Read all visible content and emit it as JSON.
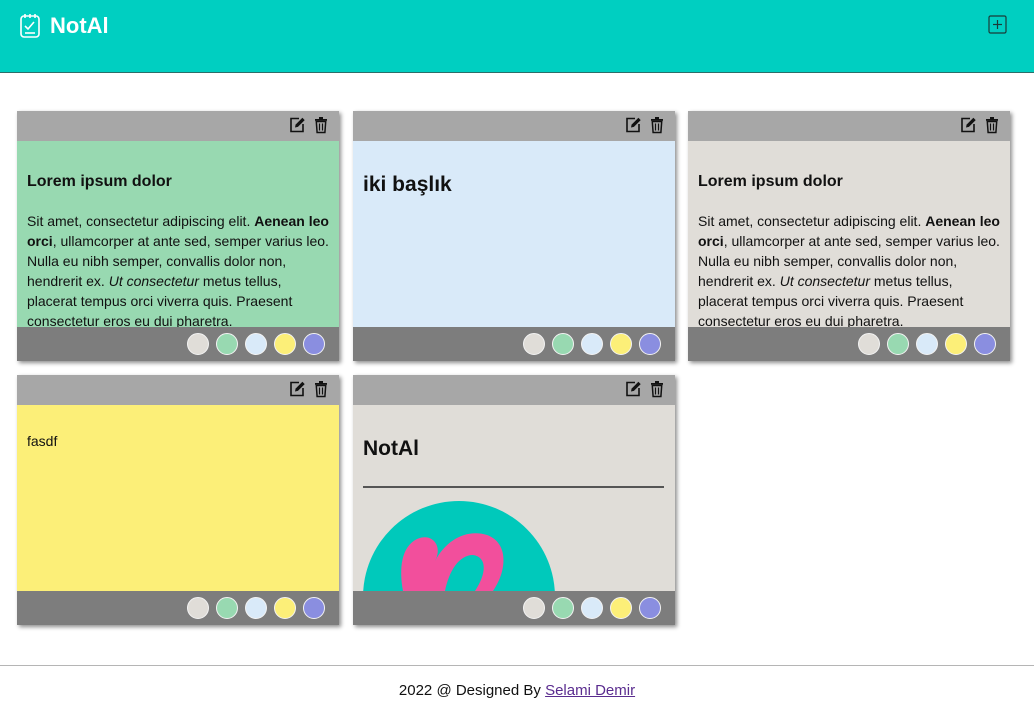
{
  "app": {
    "title": "NotAl",
    "logo_icon": "notepad-check-icon",
    "add_icon": "plus-square-icon",
    "accent": "#00cfc1"
  },
  "note_toolbar": {
    "edit_icon": "edit-icon",
    "delete_icon": "trash-icon"
  },
  "palette": [
    "#e0ddd8",
    "#98d9b1",
    "#d9eaf9",
    "#fcef78",
    "#8a8ee0"
  ],
  "notes": [
    {
      "color": "#98d9b1",
      "title": "Lorem ipsum dolor",
      "body": {
        "t1": "Sit amet, consectetur adipiscing elit. ",
        "b1": "Aenean leo orci",
        "t2": ", ullamcorper at ante sed, semper varius leo. Nulla eu nibh semper, convallis dolor non, hendrerit ex. ",
        "i1": "Ut consectetur",
        "t3": " metus tellus, placerat tempus orci viverra quis. Praesent consectetur eros eu dui pharetra."
      }
    },
    {
      "color": "#d9eaf9",
      "title": "iki başlık"
    },
    {
      "color": "#e0ddd8",
      "title": "Lorem ipsum dolor",
      "body": {
        "t1": "Sit amet, consectetur adipiscing elit. ",
        "b1": "Aenean leo orci",
        "t2": ", ullamcorper at ante sed, semper varius leo. Nulla eu nibh semper, convallis dolor non, hendrerit ex. ",
        "i1": "Ut consectetur",
        "t3": " metus tellus, placerat tempus orci viverra quis. Praesent consectetur eros eu dui pharetra."
      }
    },
    {
      "color": "#fcef78",
      "text": "fasdf"
    },
    {
      "color": "#e0ddd8",
      "title": "NotAl",
      "image_icon": "teal-circle-pink-logo-image"
    }
  ],
  "footer": {
    "prefix": "2022 @ Designed By ",
    "author": "Selami Demir"
  }
}
